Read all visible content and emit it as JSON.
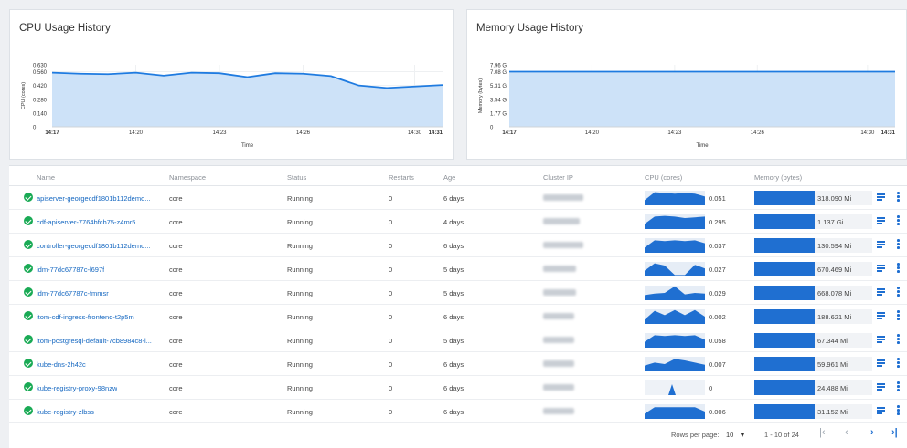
{
  "cpu_chart": {
    "title": "CPU Usage History",
    "chart_data": {
      "type": "area",
      "title": "CPU Usage History",
      "xlabel": "Time",
      "ylabel": "CPU (cores)",
      "x_ticks": [
        "14:17",
        "14:20",
        "14:23",
        "14:26",
        "14:30",
        "14:31"
      ],
      "y_ticks": [
        "0",
        "0.140",
        "0.280",
        "0.420",
        "0.560",
        "0.630"
      ],
      "ylim": [
        0,
        0.63
      ],
      "xlim_minutes": [
        0,
        14
      ],
      "x_minutes": [
        0,
        1,
        2,
        3,
        4,
        5,
        6,
        7,
        8,
        9,
        10,
        11,
        12,
        13,
        14
      ],
      "values": [
        0.55,
        0.54,
        0.535,
        0.55,
        0.52,
        0.55,
        0.545,
        0.505,
        0.545,
        0.54,
        0.515,
        0.42,
        0.395,
        0.41,
        0.425
      ],
      "grid": true,
      "fill": "#cde2f8",
      "stroke": "#1f7be0"
    }
  },
  "mem_chart": {
    "title": "Memory Usage History",
    "chart_data": {
      "type": "area",
      "title": "Memory Usage History",
      "xlabel": "Time",
      "ylabel": "Memory (bytes)",
      "x_ticks": [
        "14:17",
        "14:20",
        "14:23",
        "14:26",
        "14:30",
        "14:31"
      ],
      "y_ticks": [
        "0",
        "1.77 Gi",
        "3.54 Gi",
        "5.31 Gi",
        "7.08 Gi",
        "7.96 Gi"
      ],
      "ylim_gi": [
        0,
        7.96
      ],
      "xlim_minutes": [
        0,
        14
      ],
      "x_minutes": [
        0,
        14
      ],
      "values_gi": [
        7.08,
        7.08
      ],
      "grid": true,
      "fill": "#cde2f8",
      "stroke": "#1f7be0"
    }
  },
  "table": {
    "headers": {
      "name": "Name",
      "namespace": "Namespace",
      "status": "Status",
      "restarts": "Restarts",
      "age": "Age",
      "cluster_ip": "Cluster IP",
      "cpu": "CPU (cores)",
      "memory": "Memory (bytes)"
    },
    "rows": [
      {
        "name": "apiserver-georgecdf1801b112demo...",
        "namespace": "core",
        "status": "Running",
        "restarts": "0",
        "age": "6 days",
        "cpu": "0.051",
        "memory": "318.090 Mi",
        "spark": [
          0.35,
          0.9,
          0.85,
          0.8,
          0.85,
          0.8,
          0.6
        ],
        "mem_fraction": 1.0
      },
      {
        "name": "cdf-apiserver-7764bfcb75-z4mr5",
        "namespace": "core",
        "status": "Running",
        "restarts": "0",
        "age": "4 days",
        "cpu": "0.295",
        "memory": "1.137 Gi",
        "spark": [
          0.35,
          0.85,
          0.9,
          0.85,
          0.75,
          0.8,
          0.85
        ],
        "mem_fraction": 1.0
      },
      {
        "name": "controller-georgecdf1801b112demo...",
        "namespace": "core",
        "status": "Running",
        "restarts": "0",
        "age": "6 days",
        "cpu": "0.037",
        "memory": "130.594 Mi",
        "spark": [
          0.35,
          0.85,
          0.8,
          0.85,
          0.8,
          0.85,
          0.65
        ],
        "mem_fraction": 1.0
      },
      {
        "name": "idm-77dc67787c-l697f",
        "namespace": "core",
        "status": "Running",
        "restarts": "0",
        "age": "5 days",
        "cpu": "0.027",
        "memory": "670.469 Mi",
        "spark": [
          0.4,
          0.9,
          0.75,
          0.1,
          0.1,
          0.8,
          0.55
        ],
        "mem_fraction": 1.0
      },
      {
        "name": "idm-77dc67787c-fmmsr",
        "namespace": "core",
        "status": "Running",
        "restarts": "0",
        "age": "5 days",
        "cpu": "0.029",
        "memory": "668.078 Mi",
        "spark": [
          0.35,
          0.45,
          0.5,
          0.95,
          0.4,
          0.5,
          0.45
        ],
        "mem_fraction": 1.0
      },
      {
        "name": "itom-cdf-ingress-frontend-t2p5m",
        "namespace": "core",
        "status": "Running",
        "restarts": "0",
        "age": "6 days",
        "cpu": "0.002",
        "memory": "188.621 Mi",
        "spark": [
          0.3,
          0.9,
          0.6,
          0.95,
          0.6,
          0.95,
          0.5
        ],
        "mem_fraction": 1.0
      },
      {
        "name": "itom-postgresql-default-7cb8984c8-l...",
        "namespace": "core",
        "status": "Running",
        "restarts": "0",
        "age": "5 days",
        "cpu": "0.058",
        "memory": "67.344 Mi",
        "spark": [
          0.4,
          0.85,
          0.8,
          0.85,
          0.8,
          0.85,
          0.55
        ],
        "mem_fraction": 1.0
      },
      {
        "name": "kube-dns-2h42c",
        "namespace": "core",
        "status": "Running",
        "restarts": "0",
        "age": "6 days",
        "cpu": "0.007",
        "memory": "59.961 Mi",
        "spark": [
          0.4,
          0.6,
          0.5,
          0.85,
          0.75,
          0.6,
          0.45
        ],
        "mem_fraction": 1.0
      },
      {
        "name": "kube-registry-proxy-98nzw",
        "namespace": "core",
        "status": "Running",
        "restarts": "0",
        "age": "6 days",
        "cpu": "0",
        "memory": "24.488 Mi",
        "spark": [
          0,
          0,
          0,
          0.95,
          0,
          0,
          0
        ],
        "mem_fraction": 1.0
      },
      {
        "name": "kube-registry-zlbss",
        "namespace": "core",
        "status": "Running",
        "restarts": "0",
        "age": "6 days",
        "cpu": "0.006",
        "memory": "31.152 Mi",
        "spark": [
          0.35,
          0.8,
          0.8,
          0.8,
          0.8,
          0.8,
          0.5
        ],
        "mem_fraction": 1.0
      }
    ]
  },
  "pagination": {
    "rows_per_page_label": "Rows per page:",
    "rows_per_page_value": "10",
    "range": "1 - 10 of 24",
    "first_icon": "first-page-icon",
    "prev_icon": "chevron-left-icon",
    "next_icon": "chevron-right-icon",
    "last_icon": "last-page-icon"
  },
  "colors": {
    "accent": "#1f6fd1",
    "link": "#1668c1",
    "ok": "#1aaa55",
    "area_fill": "#cde2f8",
    "area_stroke": "#1f7be0"
  }
}
